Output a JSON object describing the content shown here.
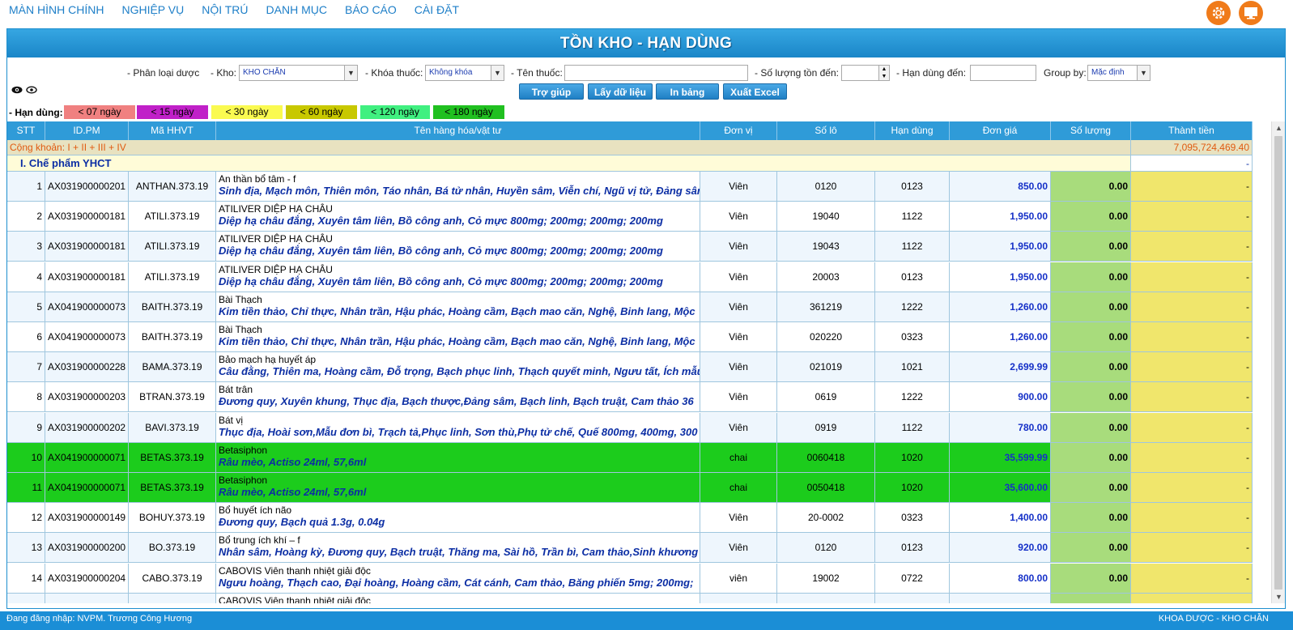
{
  "nav": {
    "items": [
      "MÀN HÌNH CHÍNH",
      "NGHIỆP VỤ",
      "NỘI TRÚ",
      "DANH MỤC",
      "BÁO CÁO",
      "CÀI ĐẶT"
    ],
    "icons": [
      "gear-icon",
      "monitor-icon"
    ]
  },
  "title": "TỒN KHO - HẠN DÙNG",
  "filters": {
    "phan_loai_label": "- Phân loại dược",
    "kho_label": "- Kho:",
    "kho_value": "KHO CHẴN",
    "khoa_thuoc_label": "- Khóa thuốc:",
    "khoa_thuoc_value": "Không khóa",
    "ten_thuoc_label": "- Tên thuốc:",
    "ten_thuoc_value": "",
    "so_luong_label": "- Số lượng tồn đến:",
    "so_luong_value": "",
    "han_dung_label": "- Hạn dùng đến:",
    "han_dung_value": "",
    "group_by_label": "Group by:",
    "group_by_value": "Mặc định"
  },
  "buttons": {
    "help": "Trợ giúp",
    "get_data": "Lấy dữ liệu",
    "print": "In bảng",
    "export": "Xuất Excel"
  },
  "legend": {
    "label": "- Hạn dùng:",
    "chips": [
      {
        "text": "< 07 ngày",
        "color": "#f08080"
      },
      {
        "text": "< 15 ngày",
        "color": "#c020c8"
      },
      {
        "text": "< 30 ngày",
        "color": "#fafa50"
      },
      {
        "text": "< 60 ngày",
        "color": "#c8c800"
      },
      {
        "text": "< 120 ngày",
        "color": "#40f080"
      },
      {
        "text": "< 180 ngày",
        "color": "#20c020"
      }
    ]
  },
  "columns": [
    "STT",
    "ID.PM",
    "Mã HHVT",
    "Tên hàng hóa/vật tư",
    "Đơn vị",
    "Số lô",
    "Hạn dùng",
    "Đơn giá",
    "Số lượng",
    "Thành tiền"
  ],
  "summary": {
    "label": "Cộng khoản: I + II + III + IV",
    "total": "7,095,724,469.40"
  },
  "group": {
    "label": "I. Chế phẩm YHCT",
    "total": "-"
  },
  "rows": [
    {
      "stt": "1",
      "id": "AX031900000201",
      "ma": "ANTHAN.373.19",
      "name": "An thần bổ tâm - f",
      "ingredients": "Sinh địa, Mạch môn, Thiên môn, Táo nhân, Bá tử nhân, Huyền sâm, Viễn chí, Ngũ vị tử, Đảng sâm",
      "unit": "Viên",
      "lot": "0120",
      "exp": "0123",
      "price": "850.00",
      "qty": "0.00",
      "total": "-",
      "highlight": false
    },
    {
      "stt": "2",
      "id": "AX031900000181",
      "ma": "ATILI.373.19",
      "name": "ATILIVER DIỆP HẠ CHÂU",
      "ingredients": "Diệp hạ châu đắng, Xuyên tâm liên, Bồ công anh, Cỏ mực 800mg; 200mg; 200mg; 200mg",
      "unit": "Viên",
      "lot": "19040",
      "exp": "1122",
      "price": "1,950.00",
      "qty": "0.00",
      "total": "-",
      "highlight": false
    },
    {
      "stt": "3",
      "id": "AX031900000181",
      "ma": "ATILI.373.19",
      "name": "ATILIVER DIỆP HẠ CHÂU",
      "ingredients": "Diệp hạ châu đắng, Xuyên tâm liên, Bồ công anh, Cỏ mực 800mg; 200mg; 200mg; 200mg",
      "unit": "Viên",
      "lot": "19043",
      "exp": "1122",
      "price": "1,950.00",
      "qty": "0.00",
      "total": "-",
      "highlight": false
    },
    {
      "stt": "4",
      "id": "AX031900000181",
      "ma": "ATILI.373.19",
      "name": "ATILIVER DIỆP HẠ CHÂU",
      "ingredients": "Diệp hạ châu đắng, Xuyên tâm liên, Bồ công anh, Cỏ mực 800mg; 200mg; 200mg; 200mg",
      "unit": "Viên",
      "lot": "20003",
      "exp": "0123",
      "price": "1,950.00",
      "qty": "0.00",
      "total": "-",
      "highlight": false
    },
    {
      "stt": "5",
      "id": "AX041900000073",
      "ma": "BAITH.373.19",
      "name": "Bài Thạch",
      "ingredients": "Kim tiền thảo, Chỉ thực, Nhân trần, Hậu phác, Hoàng cầm, Bạch mao căn, Nghệ, Binh lang, Mộc",
      "unit": "Viên",
      "lot": "361219",
      "exp": "1222",
      "price": "1,260.00",
      "qty": "0.00",
      "total": "-",
      "highlight": false
    },
    {
      "stt": "6",
      "id": "AX041900000073",
      "ma": "BAITH.373.19",
      "name": "Bài Thạch",
      "ingredients": "Kim tiền thảo, Chỉ thực, Nhân trần, Hậu phác, Hoàng cầm, Bạch mao căn, Nghệ, Binh lang, Mộc",
      "unit": "Viên",
      "lot": "020220",
      "exp": "0323",
      "price": "1,260.00",
      "qty": "0.00",
      "total": "-",
      "highlight": false
    },
    {
      "stt": "7",
      "id": "AX031900000228",
      "ma": "BAMA.373.19",
      "name": "Bảo mạch hạ huyết áp",
      "ingredients": "Câu đằng, Thiên ma, Hoàng cầm, Đỗ trọng, Bạch phục linh, Thạch quyết minh, Ngưu tất, Ích mẫu",
      "unit": "Viên",
      "lot": "021019",
      "exp": "1021",
      "price": "2,699.99",
      "qty": "0.00",
      "total": "-",
      "highlight": false
    },
    {
      "stt": "8",
      "id": "AX031900000203",
      "ma": "BTRAN.373.19",
      "name": "Bát trân",
      "ingredients": "Đương quy, Xuyên khung, Thục địa, Bạch thược,Đảng sâm, Bạch linh, Bạch truật, Cam thảo 36",
      "unit": "Viên",
      "lot": "0619",
      "exp": "1222",
      "price": "900.00",
      "qty": "0.00",
      "total": "-",
      "highlight": false
    },
    {
      "stt": "9",
      "id": "AX031900000202",
      "ma": "BAVI.373.19",
      "name": "Bát vị",
      "ingredients": "Thục địa, Hoài sơn,Mẫu đơn bì, Trạch tả,Phục linh, Sơn thù,Phụ tử chế, Quế 800mg, 400mg, 300",
      "unit": "Viên",
      "lot": "0919",
      "exp": "1122",
      "price": "780.00",
      "qty": "0.00",
      "total": "-",
      "highlight": false
    },
    {
      "stt": "10",
      "id": "AX041900000071",
      "ma": "BETAS.373.19",
      "name": "Betasiphon",
      "ingredients": "Râu mèo, Actiso 24ml, 57,6ml",
      "unit": "chai",
      "lot": "0060418",
      "exp": "1020",
      "price": "35,599.99",
      "qty": "0.00",
      "total": "-",
      "highlight": true
    },
    {
      "stt": "11",
      "id": "AX041900000071",
      "ma": "BETAS.373.19",
      "name": "Betasiphon",
      "ingredients": "Râu mèo, Actiso 24ml, 57,6ml",
      "unit": "chai",
      "lot": "0050418",
      "exp": "1020",
      "price": "35,600.00",
      "qty": "0.00",
      "total": "-",
      "highlight": true
    },
    {
      "stt": "12",
      "id": "AX031900000149",
      "ma": "BOHUY.373.19",
      "name": "Bổ huyết ích não",
      "ingredients": "Đương quy, Bạch quả 1.3g, 0.04g",
      "unit": "Viên",
      "lot": "20-0002",
      "exp": "0323",
      "price": "1,400.00",
      "qty": "0.00",
      "total": "-",
      "highlight": false
    },
    {
      "stt": "13",
      "id": "AX031900000200",
      "ma": "BO.373.19",
      "name": "Bổ trung ích khí – f",
      "ingredients": "Nhân sâm, Hoàng kỳ, Đương quy, Bạch truật, Thăng ma, Sài hồ, Trần bì, Cam thảo,Sinh khương",
      "unit": "Viên",
      "lot": "0120",
      "exp": "0123",
      "price": "920.00",
      "qty": "0.00",
      "total": "-",
      "highlight": false
    },
    {
      "stt": "14",
      "id": "AX031900000204",
      "ma": "CABO.373.19",
      "name": "CABOVIS Viên thanh nhiệt giải độc",
      "ingredients": "Ngưu hoàng, Thạch cao, Đại hoàng, Hoàng cầm, Cát cánh, Cam thảo, Băng phiến 5mg; 200mg;",
      "unit": "viên",
      "lot": "19002",
      "exp": "0722",
      "price": "800.00",
      "qty": "0.00",
      "total": "-",
      "highlight": false
    },
    {
      "stt": "",
      "id": "",
      "ma": "",
      "name": "CABOVIS Viên thanh nhiệt giải độc",
      "ingredients": "",
      "unit": "",
      "lot": "",
      "exp": "",
      "price": "",
      "qty": "",
      "total": "",
      "highlight": false
    }
  ],
  "status": {
    "left": "Đang đăng nhập: NVPM. Trương Công Hương",
    "right": "KHOA DƯỢC - KHO CHẴN"
  }
}
